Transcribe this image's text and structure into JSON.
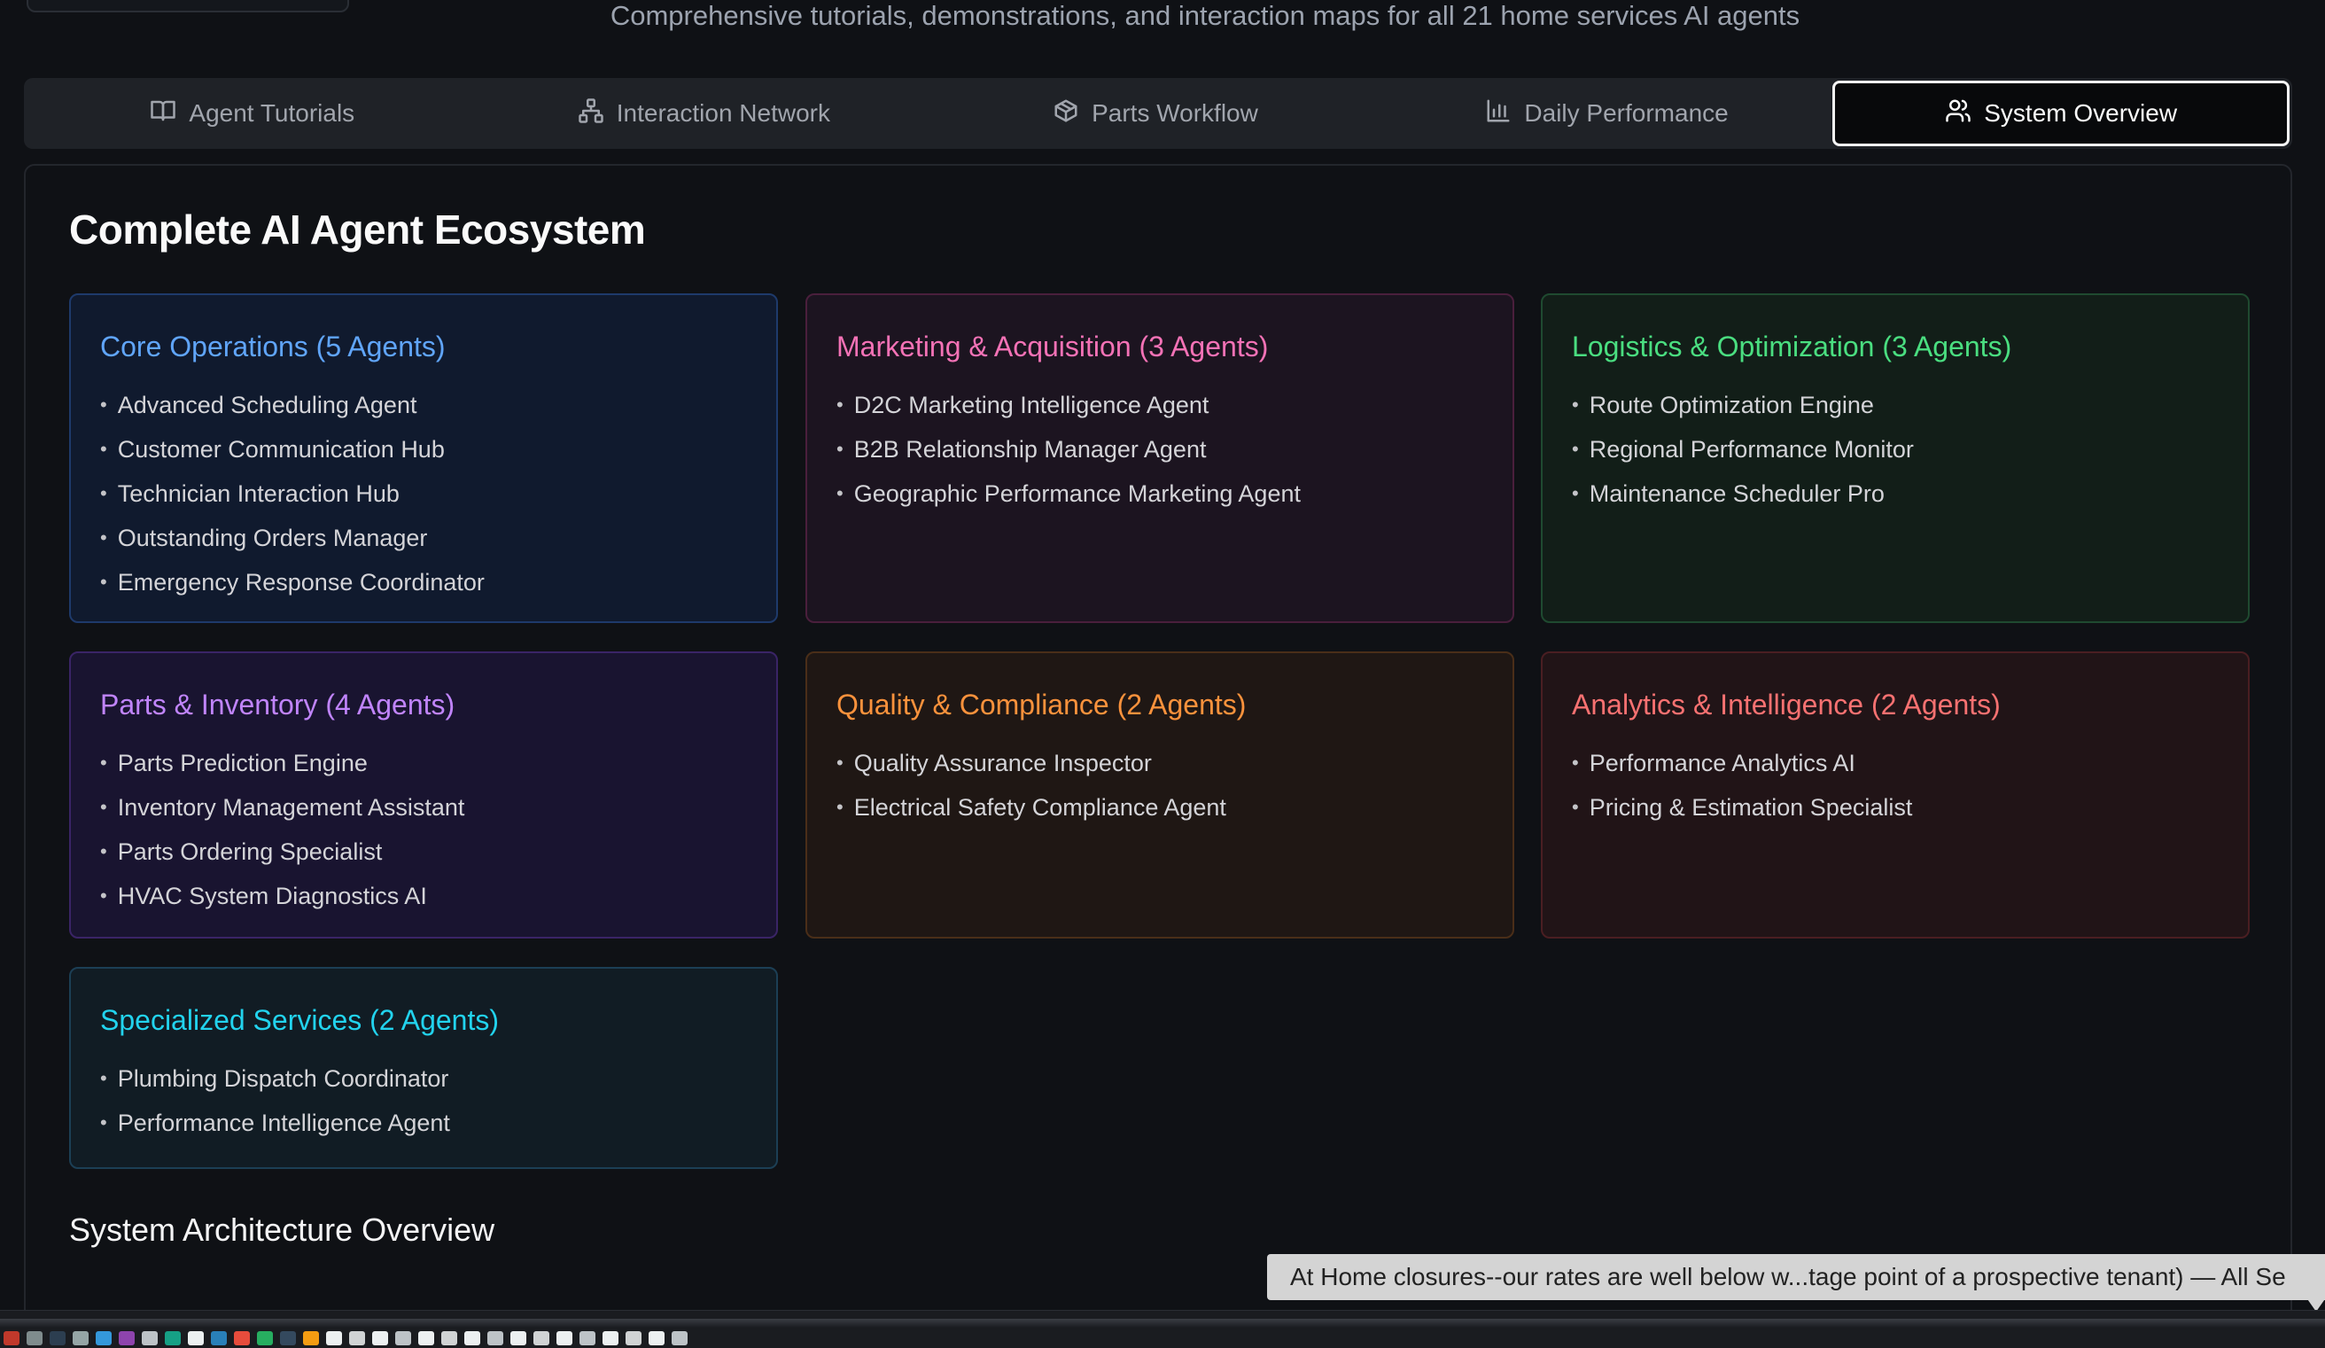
{
  "header": {
    "subtitle": "Comprehensive tutorials, demonstrations, and interaction maps for all 21 home services AI agents"
  },
  "tabs": [
    {
      "label": "Agent Tutorials",
      "icon": "book-open-icon",
      "active": false
    },
    {
      "label": "Interaction Network",
      "icon": "network-icon",
      "active": false
    },
    {
      "label": "Parts Workflow",
      "icon": "package-icon",
      "active": false
    },
    {
      "label": "Daily Performance",
      "icon": "bar-chart-icon",
      "active": false
    },
    {
      "label": "System Overview",
      "icon": "users-icon",
      "active": true
    }
  ],
  "main": {
    "title": "Complete AI Agent Ecosystem",
    "groups": [
      {
        "title": "Core Operations (5 Agents)",
        "color": "#60a5fa",
        "agents": [
          "Advanced Scheduling Agent",
          "Customer Communication Hub",
          "Technician Interaction Hub",
          "Outstanding Orders Manager",
          "Emergency Response Coordinator"
        ]
      },
      {
        "title": "Marketing & Acquisition (3 Agents)",
        "color": "#f472b6",
        "agents": [
          "D2C Marketing Intelligence Agent",
          "B2B Relationship Manager Agent",
          "Geographic Performance Marketing Agent"
        ]
      },
      {
        "title": "Logistics & Optimization (3 Agents)",
        "color": "#4ade80",
        "agents": [
          "Route Optimization Engine",
          "Regional Performance Monitor",
          "Maintenance Scheduler Pro"
        ]
      },
      {
        "title": "Parts & Inventory (4 Agents)",
        "color": "#c084fc",
        "agents": [
          "Parts Prediction Engine",
          "Inventory Management Assistant",
          "Parts Ordering Specialist",
          "HVAC System Diagnostics AI"
        ]
      },
      {
        "title": "Quality & Compliance (2 Agents)",
        "color": "#fb923c",
        "agents": [
          "Quality Assurance Inspector",
          "Electrical Safety Compliance Agent"
        ]
      },
      {
        "title": "Analytics & Intelligence (2 Agents)",
        "color": "#f87171",
        "agents": [
          "Performance Analytics AI",
          "Pricing & Estimation Specialist"
        ]
      },
      {
        "title": "Specialized Services (2 Agents)",
        "color": "#22d3ee",
        "agents": [
          "Plumbing Dispatch Coordinator",
          "Performance Intelligence Agent"
        ]
      }
    ],
    "architecture_title": "System Architecture Overview"
  },
  "tooltip": {
    "text": "At Home closures--our rates are well below w...tage point of a prospective tenant) — All Se"
  }
}
